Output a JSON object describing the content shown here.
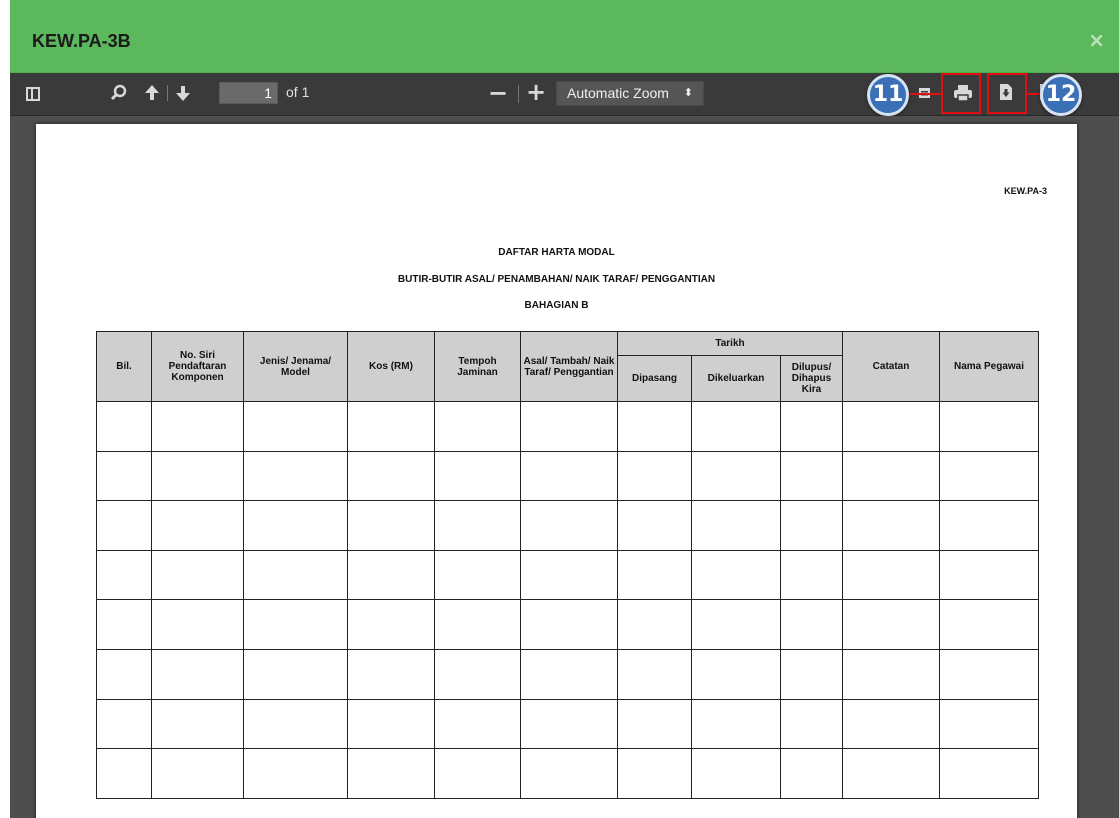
{
  "window": {
    "title": "KEW.PA-3B",
    "close_label": "×"
  },
  "toolbar": {
    "sidebar_icon": "sidebar-toggle-icon",
    "search_icon": "search-icon",
    "prev_icon": "arrow-up-icon",
    "next_icon": "arrow-down-icon",
    "page_number": "1",
    "page_count_label": "of 1",
    "zoom_out": "−",
    "zoom_in": "+",
    "zoom_value": "Automatic Zoom",
    "zoom_arrows": "⬍",
    "open_icon": "folder-open-icon",
    "print_icon": "print-icon",
    "download_icon": "download-icon",
    "bookmark_icon": "bookmark-icon"
  },
  "annotations": [
    {
      "number": "11",
      "target": "print"
    },
    {
      "number": "12",
      "target": "download"
    }
  ],
  "colors": {
    "header": "#5cb85c",
    "toolbar": "#3a3a3a",
    "badge": "#3b6fb6",
    "highlight": "#e01010"
  },
  "document": {
    "code": "KEW.PA-3",
    "title1": "DAFTAR HARTA MODAL",
    "title2": "BUTIR-BUTIR ASAL/ PENAMBAHAN/ NAIK TARAF/ PENGGANTIAN",
    "title3": "BAHAGIAN B",
    "table": {
      "headers": {
        "bil": "Bil.",
        "no_siri": "No. Siri Pendaftaran Komponen",
        "jenis": "Jenis/ Jenama/ Model",
        "kos": "Kos (RM)",
        "tempoh": "Tempoh Jaminan",
        "asal": "Asal/ Tambah/ Naik Taraf/ Penggantian",
        "tarikh": "Tarikh",
        "dipasang": "Dipasang",
        "dikeluarkan": "Dikeluarkan",
        "dilupus": "Dilupus/ Dihapus Kira",
        "catatan": "Catatan",
        "pegawai": "Nama Pegawai"
      },
      "empty_rows": 8
    }
  }
}
